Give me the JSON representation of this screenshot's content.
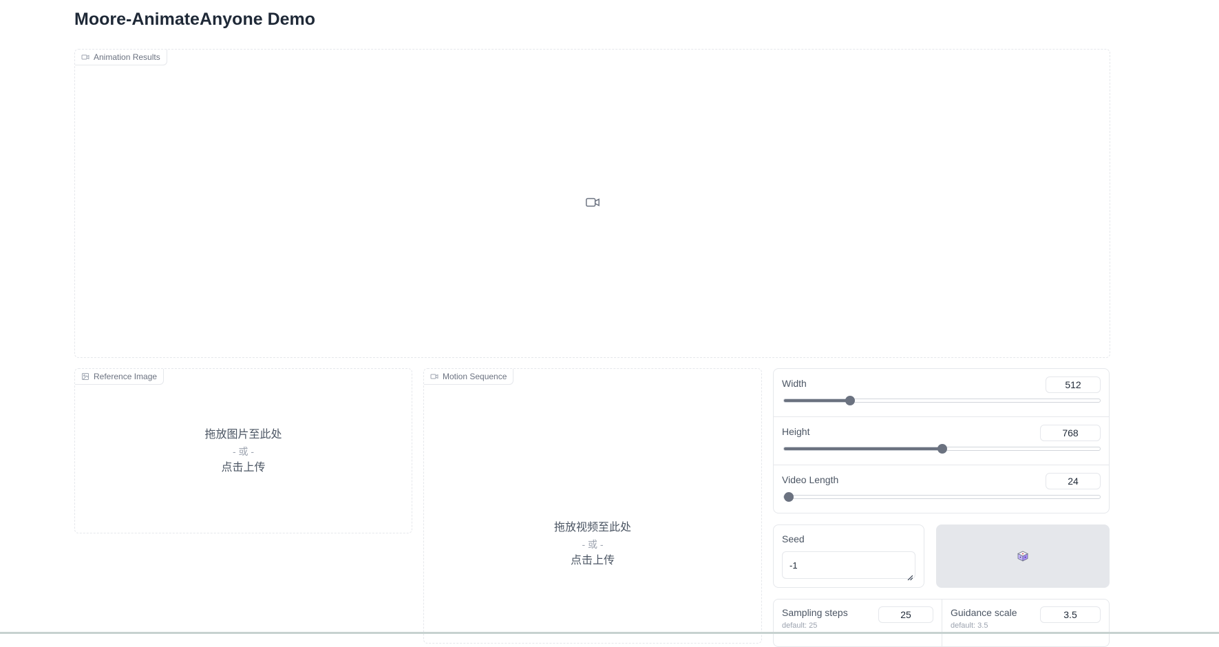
{
  "page": {
    "title": "Moore-AnimateAnyone Demo"
  },
  "animation_results": {
    "label": "Animation Results",
    "icon": "video-camera-icon"
  },
  "reference_image": {
    "label": "Reference Image",
    "icon": "image-icon",
    "drop_text": "拖放图片至此处",
    "or_text": "- 或 -",
    "click_text": "点击上传"
  },
  "motion_sequence": {
    "label": "Motion Sequence",
    "icon": "video-camera-icon",
    "drop_text": "拖放视频至此处",
    "or_text": "- 或 -",
    "click_text": "点击上传"
  },
  "sliders": {
    "width": {
      "label": "Width",
      "value": "512",
      "fraction": 0.21
    },
    "height": {
      "label": "Height",
      "value": "768",
      "fraction": 0.5
    },
    "length": {
      "label": "Video Length",
      "value": "24",
      "fraction": 0.0
    }
  },
  "seed": {
    "label": "Seed",
    "value": "-1",
    "button_icon": "dice-icon"
  },
  "sampling_steps": {
    "label": "Sampling steps",
    "value": "25",
    "default_text": "default: 25"
  },
  "guidance_scale": {
    "label": "Guidance scale",
    "value": "3.5",
    "default_text": "default: 3.5"
  }
}
